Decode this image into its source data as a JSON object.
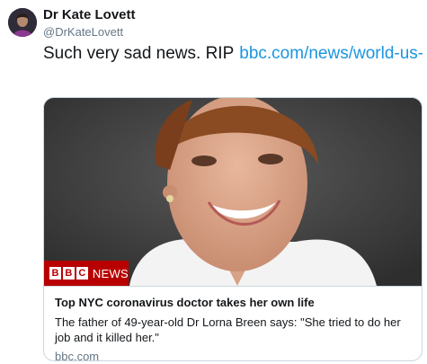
{
  "tweet": {
    "author_name": "Dr Kate Lovett",
    "author_handle": "@DrKateLovett",
    "text": "Such very sad news. RIP",
    "link_text": "bbc.com/news/world-us-…",
    "avatar_icon": "profile-photo"
  },
  "card": {
    "image_icon": "news-photo-smiling-woman",
    "logo_letters": [
      "B",
      "B",
      "C"
    ],
    "logo_word": "NEWS",
    "title": "Top NYC coronavirus doctor takes her own life",
    "description": "The father of 49-year-old Dr Lorna Breen says: \"She tried to do her job and it killed her.\"",
    "domain": "bbc.com"
  },
  "colors": {
    "link": "#1b95e0",
    "bbc_red": "#b80000",
    "muted": "#657786",
    "border": "#ccd6dd"
  }
}
